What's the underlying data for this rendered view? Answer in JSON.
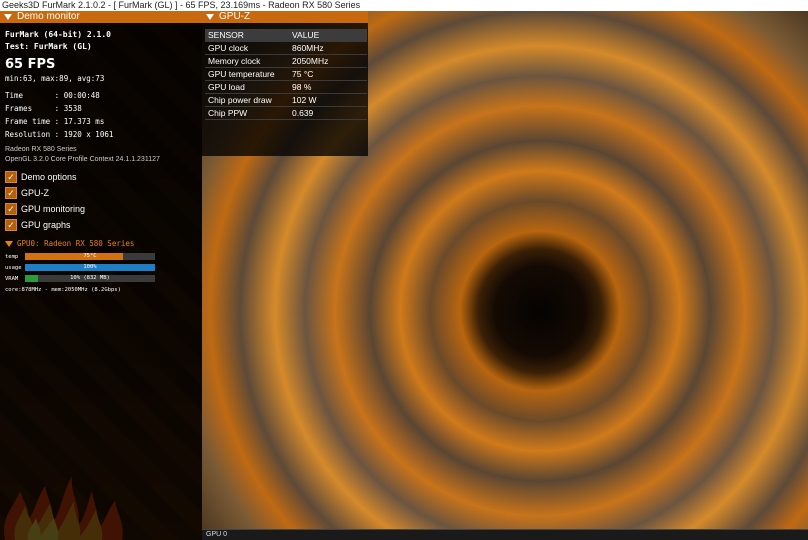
{
  "window": {
    "title": "Geeks3D FurMark 2.1.0.2 - [ FurMark (GL) ] - 65 FPS, 23.169ms - Radeon RX 580 Series"
  },
  "demo_monitor": {
    "header": "Demo monitor",
    "app_line": "FurMark (64-bit) 2.1.0",
    "test_line": "Test: FurMark (GL)",
    "fps": "65 FPS",
    "fps_stats": "min:63, max:89, avg:73",
    "time_line": "Time       : 00:00:48",
    "frames_line": "Frames     : 3538",
    "frametime_line": "Frame time : 17.373 ms",
    "resolution_line": "Resolution : 1920 x 1061",
    "gpu_name": "Radeon RX 580 Series",
    "opengl_line": "OpenGL 3.2.0 Core Profile Context 24.1.1.231127",
    "options": [
      {
        "label": "Demo options",
        "checked": true
      },
      {
        "label": "GPU-Z",
        "checked": true
      },
      {
        "label": "GPU monitoring",
        "checked": true
      },
      {
        "label": "GPU graphs",
        "checked": true
      }
    ],
    "gpu_section_header": "GPU0: Radeon RX 580 Series",
    "bars": [
      {
        "label": "temp",
        "text": "75°C",
        "fraction": 0.75,
        "color": "#d0720f"
      },
      {
        "label": "usage",
        "text": "100%",
        "fraction": 1.0,
        "color": "#1f7fc4"
      },
      {
        "label": "VRAM",
        "text": "10% (832 MB)",
        "fraction": 0.1,
        "color": "#2a9a3a"
      }
    ],
    "clock_line": "core:878MHz - mem:2050MHz (8.2Gbps)"
  },
  "gpuz": {
    "header": "GPU-Z",
    "col_sensor": "SENSOR",
    "col_value": "VALUE",
    "rows": [
      {
        "sensor": "GPU clock",
        "value": "860MHz"
      },
      {
        "sensor": "Memory clock",
        "value": "2050MHz"
      },
      {
        "sensor": "GPU temperature",
        "value": "75 °C"
      },
      {
        "sensor": "GPU load",
        "value": "98 %"
      },
      {
        "sensor": "Chip power draw",
        "value": "102 W"
      },
      {
        "sensor": "Chip PPW",
        "value": "0.639"
      }
    ]
  },
  "bottom": {
    "label": "GPU 0"
  },
  "colors": {
    "accent": "#c8690f"
  }
}
